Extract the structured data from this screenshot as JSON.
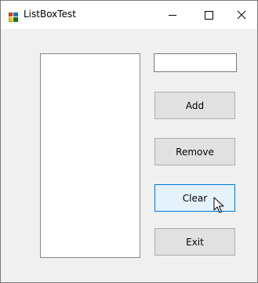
{
  "window": {
    "title": "ListBoxTest",
    "icon": "winforms-app-icon",
    "caption_buttons": [
      "minimize-icon",
      "maximize-icon",
      "close-icon"
    ]
  },
  "form": {
    "listbox_items": [],
    "textbox_value": "",
    "buttons": {
      "add": "Add",
      "remove": "Remove",
      "clear": "Clear",
      "exit": "Exit"
    },
    "hovered_button": "clear"
  },
  "colors": {
    "button_face": "#e1e1e1",
    "button_hover": "#e5f1fb",
    "hover_border": "#0078d7"
  }
}
